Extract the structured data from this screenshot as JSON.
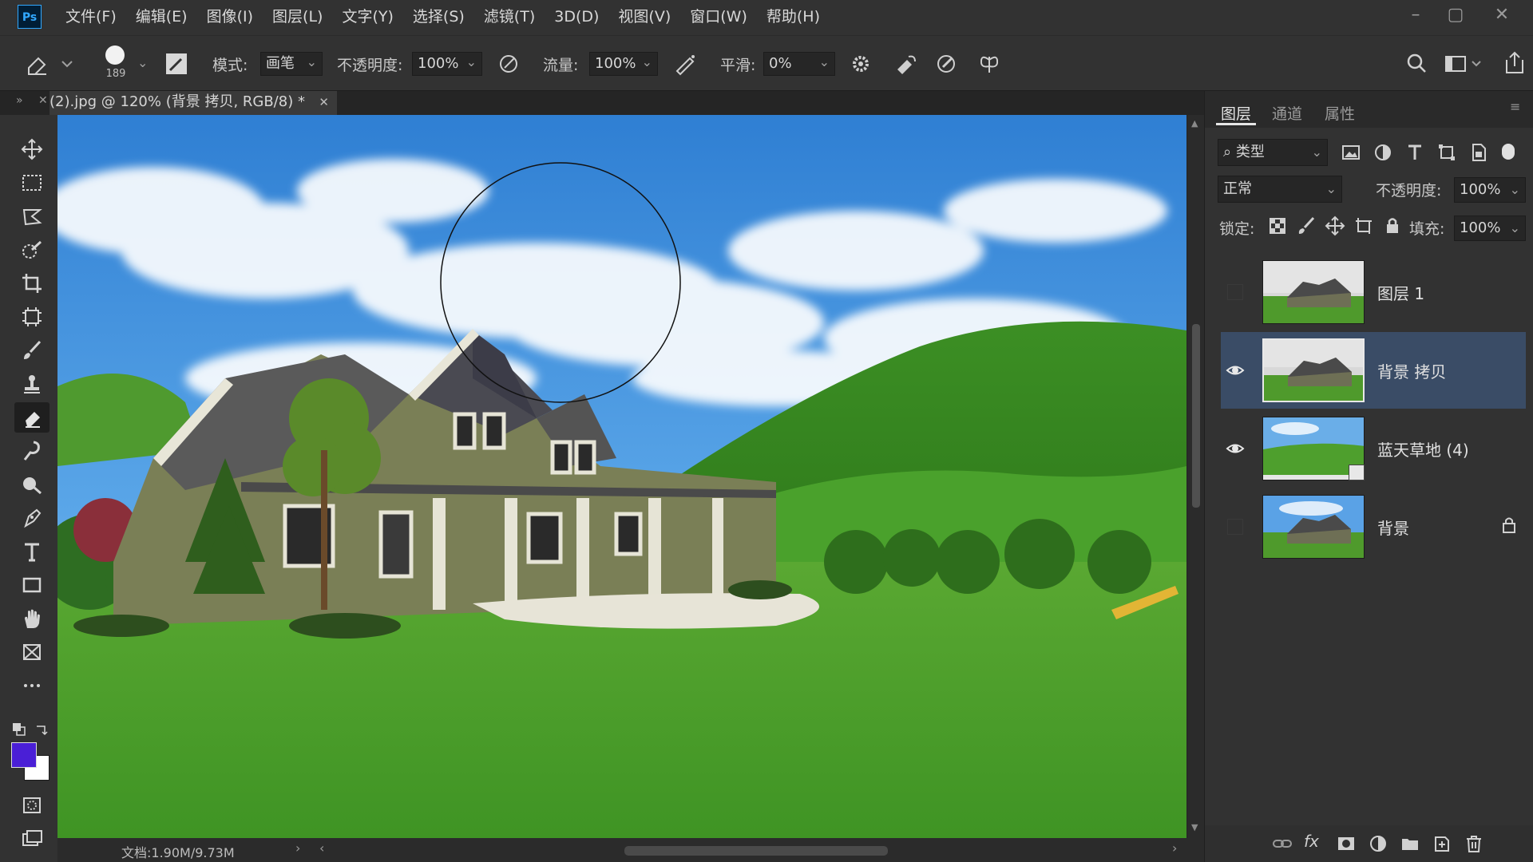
{
  "app": {
    "logo": "Ps"
  },
  "menu": [
    "文件(F)",
    "编辑(E)",
    "图像(I)",
    "图层(L)",
    "文字(Y)",
    "选择(S)",
    "滤镜(T)",
    "3D(D)",
    "视图(V)",
    "窗口(W)",
    "帮助(H)"
  ],
  "options": {
    "brush_size": "189",
    "mode_label": "模式:",
    "mode_value": "画笔",
    "opacity_label": "不透明度:",
    "opacity_value": "100%",
    "flow_label": "流量:",
    "flow_value": "100%",
    "smooth_label": "平滑:",
    "smooth_value": "0%"
  },
  "document": {
    "tab_title": "(2).jpg @ 120% (背景 拷贝, RGB/8) *",
    "status": "文档:1.90M/9.73M"
  },
  "colors": {
    "foreground": "#4a1fd6",
    "background": "#ffffff",
    "selection": "#3a4c66"
  },
  "layers_panel": {
    "tabs": [
      "图层",
      "通道",
      "属性"
    ],
    "filter_label": "类型",
    "blend_mode": "正常",
    "opacity_label": "不透明度:",
    "opacity_value": "100%",
    "lock_label": "锁定:",
    "fill_label": "填充:",
    "fill_value": "100%",
    "layers": [
      {
        "name": "图层 1",
        "visible": false,
        "selected": false
      },
      {
        "name": "背景 拷贝",
        "visible": true,
        "selected": true
      },
      {
        "name": "蓝天草地 (4)",
        "visible": true,
        "selected": false
      },
      {
        "name": "背景",
        "visible": false,
        "selected": false,
        "locked": true
      }
    ]
  },
  "icons": {
    "toolbar": [
      "move-icon",
      "marquee-icon",
      "lasso-icon",
      "quick-select-icon",
      "crop-icon",
      "frame-icon",
      "brush-icon",
      "stamp-icon",
      "eraser-icon",
      "smudge-icon",
      "dodge-icon",
      "pen-icon",
      "type-icon",
      "rectangle-icon",
      "hand-icon",
      "artboard-icon",
      "more-icon"
    ]
  }
}
